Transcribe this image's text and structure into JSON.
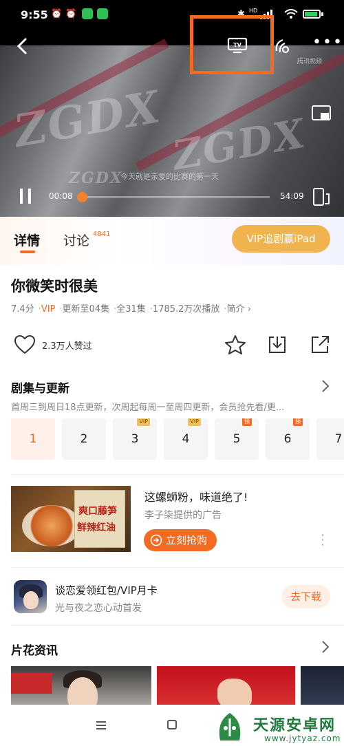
{
  "status_bar": {
    "time": "9:55",
    "network": "HD"
  },
  "player": {
    "subtitle": "今天就是亲爱的比赛的第一天",
    "watermark": "腾讯视频",
    "current_time": "00:08",
    "total_time": "54:09",
    "progress": 0.025,
    "bus_text": [
      "ZGDX",
      "ZGDX",
      "ZGDX"
    ]
  },
  "tabs": {
    "detail": "详情",
    "discuss": "讨论",
    "discuss_count": "4841",
    "vip_promo": "VIP追剧赢iPad"
  },
  "show": {
    "title": "你微笑时很美",
    "rating": "7.4分",
    "vip": "VIP",
    "update": "更新至04集",
    "total": "全31集",
    "plays": "1785.2万次播放",
    "intro": "简介"
  },
  "actions": {
    "likes": "2.3万人赞过"
  },
  "episodes": {
    "title": "剧集与更新",
    "desc": "首周三到周日18点更新，次周起每周一至周四更新，会员抢先看/更...",
    "items": [
      {
        "label": "1",
        "badge": ""
      },
      {
        "label": "2",
        "badge": ""
      },
      {
        "label": "3",
        "badge": "VIP"
      },
      {
        "label": "4",
        "badge": "VIP"
      },
      {
        "label": "5",
        "badge": "预"
      },
      {
        "label": "6",
        "badge": "预"
      },
      {
        "label": "7",
        "badge": ""
      }
    ]
  },
  "ad": {
    "title": "这螺蛳粉，味道绝了!",
    "subtitle": "李子柒提供的广告",
    "button": "立刻抢购",
    "image_text_1": "爽口藤笋",
    "image_text_2": "鲜辣红油"
  },
  "game": {
    "title": "谈恋爱领红包/VIP月卡",
    "subtitle": "光与夜之恋心动首发",
    "button": "去下载"
  },
  "clips": {
    "title": "片花资讯"
  },
  "site": {
    "name": "天源安卓网",
    "url": "www.jytyaz.com"
  },
  "colors": {
    "accent": "#f36a22",
    "vip_gold": "#f1b34e",
    "highlight_box": "#f36a22"
  }
}
